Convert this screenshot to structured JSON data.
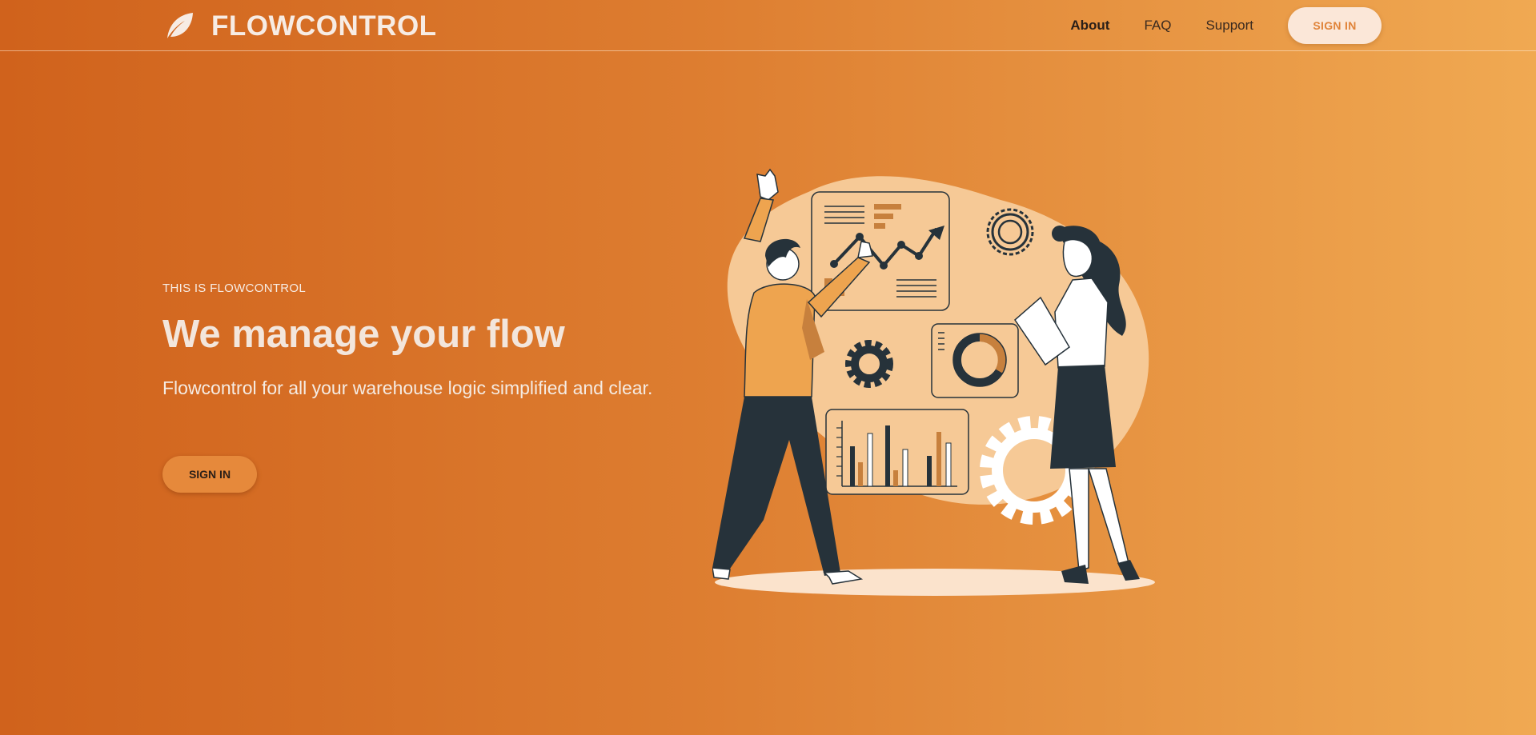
{
  "brand": {
    "name": "FLOWCONTROL",
    "logo_icon": "leaf-icon"
  },
  "nav": {
    "links": [
      {
        "label": "About",
        "active": true
      },
      {
        "label": "FAQ",
        "active": false
      },
      {
        "label": "Support",
        "active": false
      }
    ],
    "signin_label": "SIGN IN"
  },
  "hero": {
    "eyebrow": "THIS IS FLOWCONTROL",
    "title": "We manage your flow",
    "subtitle": "Flowcontrol for all your warehouse logic simplified and clear.",
    "cta_label": "SIGN IN"
  },
  "colors": {
    "gradient_start": "#d0621c",
    "gradient_end": "#f0a952",
    "accent_light": "#fbe7d8",
    "cta": "#e6893b",
    "ink": "#26323a"
  }
}
